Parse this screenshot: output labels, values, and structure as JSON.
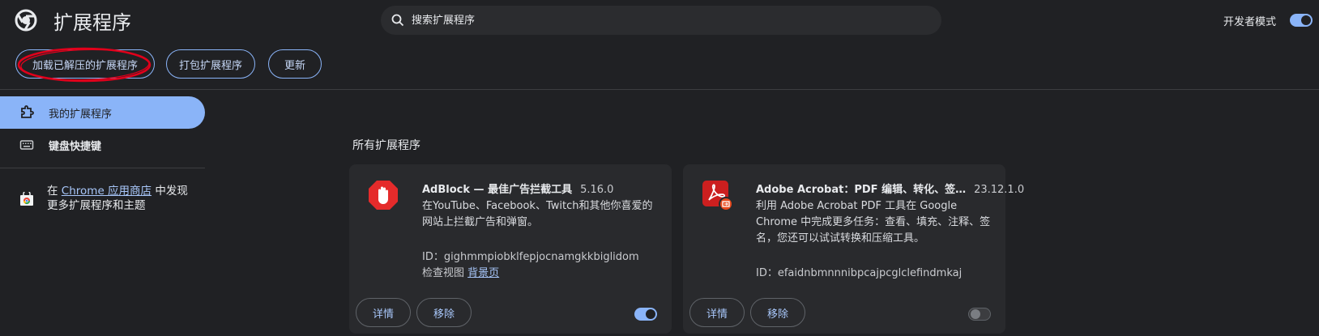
{
  "header": {
    "title": "扩展程序",
    "search_placeholder": "搜索扩展程序",
    "developer_mode_label": "开发者模式",
    "developer_mode_on": true
  },
  "toolbar": {
    "load_unpacked": "加载已解压的扩展程序",
    "pack_extension": "打包扩展程序",
    "update": "更新",
    "annotation_color": "#e0001b"
  },
  "sidebar": {
    "items": [
      {
        "label": "我的扩展程序",
        "icon": "puzzle-icon",
        "selected": true
      },
      {
        "label": "键盘快捷键",
        "icon": "keyboard-icon",
        "selected": false
      }
    ],
    "promo_prefix": "在 ",
    "promo_link": "Chrome 应用商店",
    "promo_suffix": " 中发现更多扩展程序和主题"
  },
  "main": {
    "section_title": "所有扩展程序",
    "extensions": [
      {
        "name": "AdBlock — 最佳广告拦截工具",
        "version": "5.16.0",
        "description": "在YouTube、Facebook、Twitch和其他你喜爱的网站上拦截广告和弹窗。",
        "id": "ID：gighmmpiobklfepjocnamgkkbiglidom",
        "inspect_label": "检查视图",
        "inspect_link": "背景页",
        "details": "详情",
        "remove": "移除",
        "enabled": true,
        "icon": "adblock-hand-icon"
      },
      {
        "name": "Adobe Acrobat：PDF 编辑、转化、签…",
        "version": "23.12.1.0",
        "description": "利用 Adobe Acrobat PDF 工具在 Google Chrome 中完成更多任务：查看、填充、注释、签名，您还可以试试转换和压缩工具。",
        "id": "ID：efaidnbmnnnibpcajpcglclefindmkaj",
        "details": "详情",
        "remove": "移除",
        "enabled": false,
        "icon": "acrobat-icon"
      }
    ]
  },
  "colors": {
    "background": "#202124",
    "accent": "#8ab4f8",
    "card": "#292a2d",
    "adblock_red": "#e52b2b",
    "acrobat_red": "#cc1f1f"
  }
}
